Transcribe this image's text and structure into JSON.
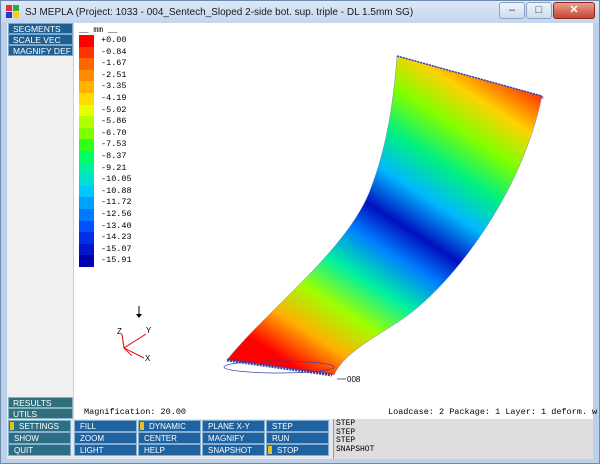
{
  "window": {
    "title": "SJ MEPLA (Project: 1033 - 004_Sentech_Sloped 2-side bot. sup. triple - DL 1.5mm SG)",
    "controls": {
      "minimize": "–",
      "maximize": "□",
      "close": "✕"
    }
  },
  "left_menu": {
    "top": [
      "SEGMENTS",
      "SCALE VEC",
      "MAGNIFY DEF"
    ],
    "bottom": [
      "RESULTS",
      "UTILS"
    ]
  },
  "legend": {
    "unit_label": "__ mm __",
    "values": [
      "+0.00",
      "-0.84",
      "-1.67",
      "-2.51",
      "-3.35",
      "-4.19",
      "-5.02",
      "-5.86",
      "-6.70",
      "-7.53",
      "-8.37",
      "-9.21",
      "-10.05",
      "-10.88",
      "-11.72",
      "-12.56",
      "-13.40",
      "-14.23",
      "-15.07",
      "-15.91"
    ],
    "colors": [
      "#ff0000",
      "#ff3300",
      "#ff6600",
      "#ff8c00",
      "#ffb300",
      "#ffd900",
      "#e6ff00",
      "#b3ff00",
      "#80ff00",
      "#33ff1a",
      "#00ff66",
      "#00f0a0",
      "#00e0d0",
      "#00c8ff",
      "#00a0ff",
      "#0078ff",
      "#0050ff",
      "#0030e6",
      "#0018c8",
      "#0000b0"
    ]
  },
  "axes": {
    "x": "X",
    "y": "Y",
    "z": "Z"
  },
  "node_label": "008",
  "status": {
    "magnification": "Magnification: 20.00",
    "loadcase": "Loadcase:  2 Package: 1 Layer: 1 deform. w"
  },
  "toolbar": {
    "col0": [
      "SETTINGS",
      "SHOW",
      "QUIT"
    ],
    "col1": [
      "FILL",
      "ZOOM",
      "LIGHT"
    ],
    "col2": [
      "DYNAMIC",
      "CENTER",
      "HELP"
    ],
    "col3": [
      "PLANE X-Y",
      "MAGNIFY",
      "SNAPSHOT"
    ],
    "col4": [
      "STEP",
      "RUN",
      "STOP"
    ]
  },
  "log": [
    "STEP",
    "STEP",
    "STEP",
    "SNAPSHOT"
  ]
}
